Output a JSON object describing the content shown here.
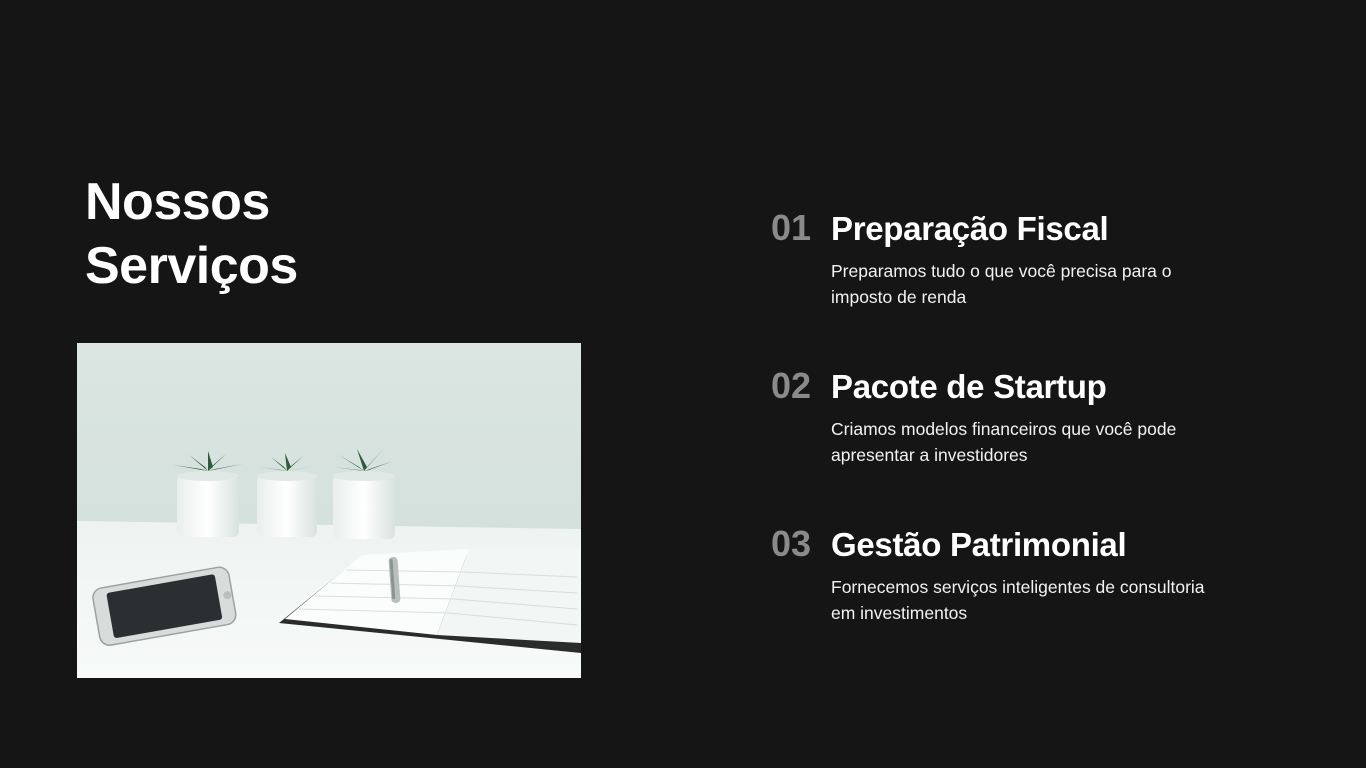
{
  "header": {
    "title_line1": "Nossos",
    "title_line2": "Serviços"
  },
  "image": {
    "description_icon": "workspace-photo"
  },
  "services": [
    {
      "number": "01",
      "title": "Preparação Fiscal",
      "description": "Preparamos tudo o que você precisa para o imposto de renda"
    },
    {
      "number": "02",
      "title": "Pacote de Startup",
      "description": "Criamos modelos financeiros que você pode apresentar a investidores"
    },
    {
      "number": "03",
      "title": "Gestão Patrimonial",
      "description": "Fornecemos serviços inteligentes de consultoria em investimentos"
    }
  ],
  "colors": {
    "background": "#151515",
    "text": "#ffffff",
    "number": "#8a8a8a"
  }
}
